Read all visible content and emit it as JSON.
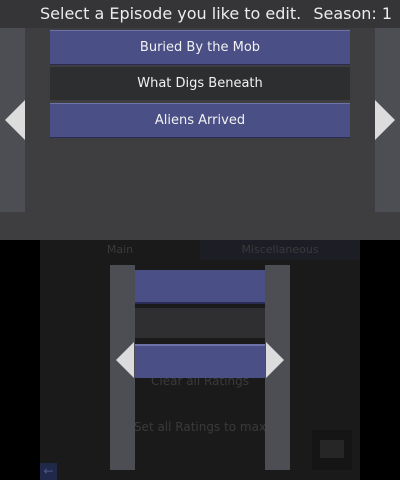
{
  "top": {
    "header": {
      "title": "Select a Episode you like to edit.",
      "season_label": "Season:",
      "season_value": "1"
    },
    "episodes": [
      {
        "title": "Buried By the Mob"
      },
      {
        "title": "What Digs Beneath"
      },
      {
        "title": "Aliens Arrived"
      }
    ],
    "icons": {
      "left_arrow": "left-triangle-icon",
      "right_arrow": "right-triangle-icon",
      "character": "mario-icon"
    }
  },
  "bottom": {
    "tabs": [
      {
        "label": "Main"
      },
      {
        "label": "Miscellaneous"
      }
    ],
    "options": {
      "clear_ratings": "Clear all Ratings",
      "set_all_ratings": "Set all Ratings to max"
    },
    "back_icon": "←"
  },
  "colors": {
    "selected_item": "#4a4f86",
    "panel_gray": "#4d4e54",
    "background": "#3e3e41"
  }
}
